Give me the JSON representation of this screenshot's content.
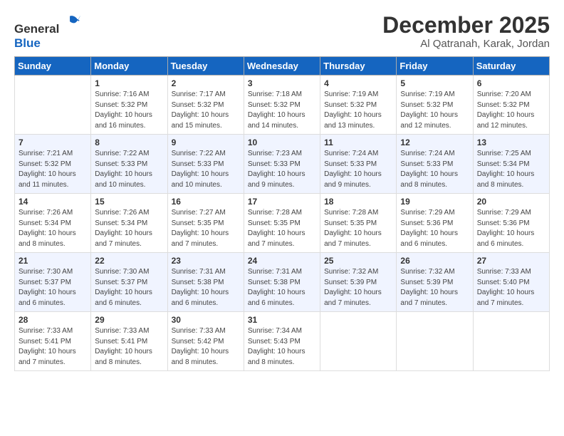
{
  "logo": {
    "general": "General",
    "blue": "Blue"
  },
  "title": "December 2025",
  "location": "Al Qatranah, Karak, Jordan",
  "weekdays": [
    "Sunday",
    "Monday",
    "Tuesday",
    "Wednesday",
    "Thursday",
    "Friday",
    "Saturday"
  ],
  "weeks": [
    [
      {
        "day": "",
        "sunrise": "",
        "sunset": "",
        "daylight": ""
      },
      {
        "day": "1",
        "sunrise": "7:16 AM",
        "sunset": "5:32 PM",
        "daylight": "10 hours and 16 minutes."
      },
      {
        "day": "2",
        "sunrise": "7:17 AM",
        "sunset": "5:32 PM",
        "daylight": "10 hours and 15 minutes."
      },
      {
        "day": "3",
        "sunrise": "7:18 AM",
        "sunset": "5:32 PM",
        "daylight": "10 hours and 14 minutes."
      },
      {
        "day": "4",
        "sunrise": "7:19 AM",
        "sunset": "5:32 PM",
        "daylight": "10 hours and 13 minutes."
      },
      {
        "day": "5",
        "sunrise": "7:19 AM",
        "sunset": "5:32 PM",
        "daylight": "10 hours and 12 minutes."
      },
      {
        "day": "6",
        "sunrise": "7:20 AM",
        "sunset": "5:32 PM",
        "daylight": "10 hours and 12 minutes."
      }
    ],
    [
      {
        "day": "7",
        "sunrise": "7:21 AM",
        "sunset": "5:32 PM",
        "daylight": "10 hours and 11 minutes."
      },
      {
        "day": "8",
        "sunrise": "7:22 AM",
        "sunset": "5:33 PM",
        "daylight": "10 hours and 10 minutes."
      },
      {
        "day": "9",
        "sunrise": "7:22 AM",
        "sunset": "5:33 PM",
        "daylight": "10 hours and 10 minutes."
      },
      {
        "day": "10",
        "sunrise": "7:23 AM",
        "sunset": "5:33 PM",
        "daylight": "10 hours and 9 minutes."
      },
      {
        "day": "11",
        "sunrise": "7:24 AM",
        "sunset": "5:33 PM",
        "daylight": "10 hours and 9 minutes."
      },
      {
        "day": "12",
        "sunrise": "7:24 AM",
        "sunset": "5:33 PM",
        "daylight": "10 hours and 8 minutes."
      },
      {
        "day": "13",
        "sunrise": "7:25 AM",
        "sunset": "5:34 PM",
        "daylight": "10 hours and 8 minutes."
      }
    ],
    [
      {
        "day": "14",
        "sunrise": "7:26 AM",
        "sunset": "5:34 PM",
        "daylight": "10 hours and 8 minutes."
      },
      {
        "day": "15",
        "sunrise": "7:26 AM",
        "sunset": "5:34 PM",
        "daylight": "10 hours and 7 minutes."
      },
      {
        "day": "16",
        "sunrise": "7:27 AM",
        "sunset": "5:35 PM",
        "daylight": "10 hours and 7 minutes."
      },
      {
        "day": "17",
        "sunrise": "7:28 AM",
        "sunset": "5:35 PM",
        "daylight": "10 hours and 7 minutes."
      },
      {
        "day": "18",
        "sunrise": "7:28 AM",
        "sunset": "5:35 PM",
        "daylight": "10 hours and 7 minutes."
      },
      {
        "day": "19",
        "sunrise": "7:29 AM",
        "sunset": "5:36 PM",
        "daylight": "10 hours and 6 minutes."
      },
      {
        "day": "20",
        "sunrise": "7:29 AM",
        "sunset": "5:36 PM",
        "daylight": "10 hours and 6 minutes."
      }
    ],
    [
      {
        "day": "21",
        "sunrise": "7:30 AM",
        "sunset": "5:37 PM",
        "daylight": "10 hours and 6 minutes."
      },
      {
        "day": "22",
        "sunrise": "7:30 AM",
        "sunset": "5:37 PM",
        "daylight": "10 hours and 6 minutes."
      },
      {
        "day": "23",
        "sunrise": "7:31 AM",
        "sunset": "5:38 PM",
        "daylight": "10 hours and 6 minutes."
      },
      {
        "day": "24",
        "sunrise": "7:31 AM",
        "sunset": "5:38 PM",
        "daylight": "10 hours and 6 minutes."
      },
      {
        "day": "25",
        "sunrise": "7:32 AM",
        "sunset": "5:39 PM",
        "daylight": "10 hours and 7 minutes."
      },
      {
        "day": "26",
        "sunrise": "7:32 AM",
        "sunset": "5:39 PM",
        "daylight": "10 hours and 7 minutes."
      },
      {
        "day": "27",
        "sunrise": "7:33 AM",
        "sunset": "5:40 PM",
        "daylight": "10 hours and 7 minutes."
      }
    ],
    [
      {
        "day": "28",
        "sunrise": "7:33 AM",
        "sunset": "5:41 PM",
        "daylight": "10 hours and 7 minutes."
      },
      {
        "day": "29",
        "sunrise": "7:33 AM",
        "sunset": "5:41 PM",
        "daylight": "10 hours and 8 minutes."
      },
      {
        "day": "30",
        "sunrise": "7:33 AM",
        "sunset": "5:42 PM",
        "daylight": "10 hours and 8 minutes."
      },
      {
        "day": "31",
        "sunrise": "7:34 AM",
        "sunset": "5:43 PM",
        "daylight": "10 hours and 8 minutes."
      },
      {
        "day": "",
        "sunrise": "",
        "sunset": "",
        "daylight": ""
      },
      {
        "day": "",
        "sunrise": "",
        "sunset": "",
        "daylight": ""
      },
      {
        "day": "",
        "sunrise": "",
        "sunset": "",
        "daylight": ""
      }
    ]
  ]
}
